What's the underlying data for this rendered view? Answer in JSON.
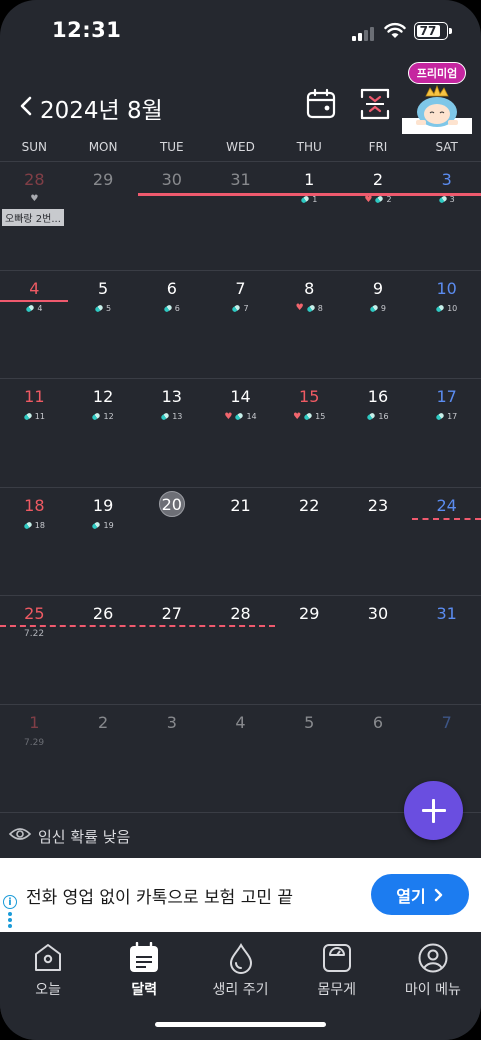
{
  "status": {
    "time": "12:31",
    "battery": "77"
  },
  "header": {
    "title": "2024년 8월",
    "premium_label": "프리미엄"
  },
  "weekdays": [
    "SUN",
    "MON",
    "TUE",
    "WED",
    "THU",
    "FRI",
    "SAT"
  ],
  "weeks": [
    [
      {
        "num": "28",
        "kind": "sun",
        "dim": true,
        "heart_gray": true,
        "note": "오빠랑 2번..."
      },
      {
        "num": "29",
        "dim": true
      },
      {
        "num": "30",
        "dim": true
      },
      {
        "num": "31",
        "dim": true
      },
      {
        "num": "1",
        "pill": "1"
      },
      {
        "num": "2",
        "heart": true,
        "pill": "2"
      },
      {
        "num": "3",
        "kind": "sat",
        "pill": "3"
      }
    ],
    [
      {
        "num": "4",
        "kind": "sun",
        "pill": "4"
      },
      {
        "num": "5",
        "pill": "5"
      },
      {
        "num": "6",
        "pill": "6"
      },
      {
        "num": "7",
        "pill": "7"
      },
      {
        "num": "8",
        "heart": true,
        "pill": "8"
      },
      {
        "num": "9",
        "pill": "9"
      },
      {
        "num": "10",
        "kind": "sat",
        "pill": "10"
      }
    ],
    [
      {
        "num": "11",
        "kind": "sun",
        "pill": "11"
      },
      {
        "num": "12",
        "pill": "12"
      },
      {
        "num": "13",
        "pill": "13"
      },
      {
        "num": "14",
        "heart": true,
        "pill": "14"
      },
      {
        "num": "15",
        "kind": "sun",
        "heart": true,
        "pill": "15"
      },
      {
        "num": "16",
        "pill": "16"
      },
      {
        "num": "17",
        "kind": "sat",
        "pill": "17"
      }
    ],
    [
      {
        "num": "18",
        "kind": "sun",
        "pill": "18"
      },
      {
        "num": "19",
        "pill": "19"
      },
      {
        "num": "20",
        "today": true
      },
      {
        "num": "21"
      },
      {
        "num": "22"
      },
      {
        "num": "23"
      },
      {
        "num": "24",
        "kind": "sat"
      }
    ],
    [
      {
        "num": "25",
        "kind": "sun",
        "small": "7.22"
      },
      {
        "num": "26"
      },
      {
        "num": "27"
      },
      {
        "num": "28"
      },
      {
        "num": "29"
      },
      {
        "num": "30"
      },
      {
        "num": "31",
        "kind": "sat"
      }
    ],
    [
      {
        "num": "1",
        "kind": "sun",
        "dim": true,
        "small": "7.29"
      },
      {
        "num": "2",
        "dim": true
      },
      {
        "num": "3",
        "dim": true
      },
      {
        "num": "4",
        "dim": true
      },
      {
        "num": "5",
        "dim": true
      },
      {
        "num": "6",
        "dim": true
      },
      {
        "num": "7",
        "kind": "sat",
        "dim": true
      }
    ]
  ],
  "footer": {
    "probability": "임신 확률 낮음"
  },
  "ad": {
    "text": "전화 영업 없이 카톡으로 보험 고민 끝",
    "button": "열기"
  },
  "tabs": [
    {
      "label": "오늘",
      "icon": "home-icon"
    },
    {
      "label": "달력",
      "icon": "calendar-icon",
      "active": true
    },
    {
      "label": "생리 주기",
      "icon": "drop-icon"
    },
    {
      "label": "몸무게",
      "icon": "scale-icon"
    },
    {
      "label": "마이 메뉴",
      "icon": "profile-icon"
    }
  ],
  "colors": {
    "accent": "#6a4ee0",
    "period": "#ef5a6e",
    "background": "#25282f",
    "ad_button": "#1c7cf0"
  }
}
